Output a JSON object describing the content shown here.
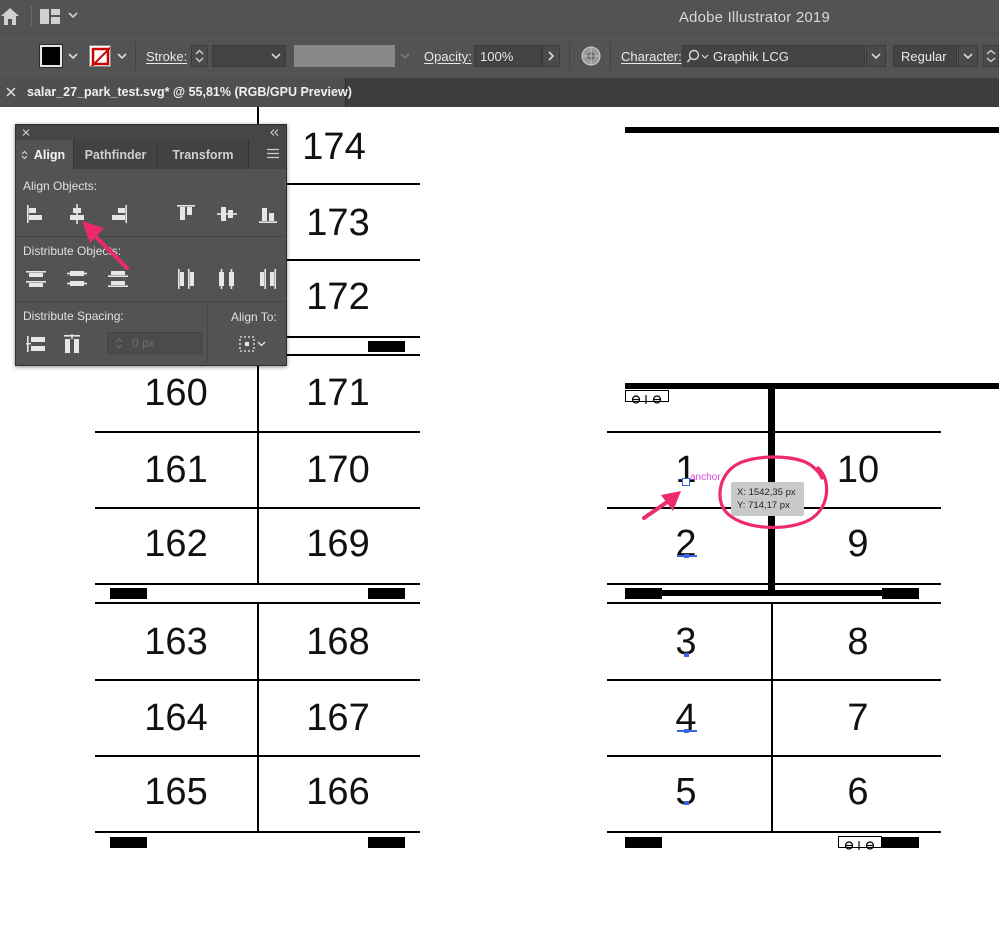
{
  "app": {
    "title": "Adobe Illustrator 2019"
  },
  "titlebar": {
    "icons": [
      "home-icon",
      "workspace-switcher-icon",
      "chevron-down-icon"
    ]
  },
  "control_bar": {
    "fill_color": "#000000",
    "stroke_swatch": "none",
    "stroke_label": "Stroke:",
    "stroke_weight": "",
    "opacity_label": "Opacity:",
    "opacity_value": "100%",
    "character_label": "Character:",
    "font_family": "Graphik LCG",
    "font_style": "Regular"
  },
  "document_tab": {
    "title": "salar_27_park_test.svg* @ 55,81% (RGB/GPU Preview)"
  },
  "align_panel": {
    "tabs": [
      {
        "label": "Align",
        "active": true
      },
      {
        "label": "Pathfinder",
        "active": false
      },
      {
        "label": "Transform",
        "active": false
      }
    ],
    "align_objects_label": "Align Objects:",
    "distribute_objects_label": "Distribute Objects:",
    "distribute_spacing_label": "Distribute Spacing:",
    "align_to_label": "Align To:",
    "spacing_value": "0 px",
    "align_object_icons": [
      "horizontal-align-left-icon",
      "horizontal-align-center-icon",
      "horizontal-align-right-icon",
      "vertical-align-top-icon",
      "vertical-align-center-icon",
      "vertical-align-bottom-icon"
    ],
    "distribute_object_icons": [
      "vertical-distribute-top-icon",
      "vertical-distribute-center-icon",
      "vertical-distribute-bottom-icon",
      "horizontal-distribute-left-icon",
      "horizontal-distribute-center-icon",
      "horizontal-distribute-right-icon"
    ]
  },
  "artwork": {
    "left_block": {
      "right_column_top": [
        "174",
        "173",
        "172"
      ],
      "rows": [
        [
          "160",
          "171"
        ],
        [
          "161",
          "170"
        ],
        [
          "162",
          "169"
        ],
        [
          "163",
          "168"
        ],
        [
          "164",
          "167"
        ],
        [
          "165",
          "166"
        ]
      ]
    },
    "right_block": {
      "rows": [
        [
          "1",
          "10"
        ],
        [
          "2",
          "9"
        ],
        [
          "3",
          "8"
        ],
        [
          "4",
          "7"
        ],
        [
          "5",
          "6"
        ]
      ]
    }
  },
  "hover_tooltip": {
    "anchor_label": "anchor",
    "x_readout": "X: 1542,35 px",
    "y_readout": "Y: 714,17 px"
  },
  "annotation": {
    "color": "#ee2a6e"
  }
}
